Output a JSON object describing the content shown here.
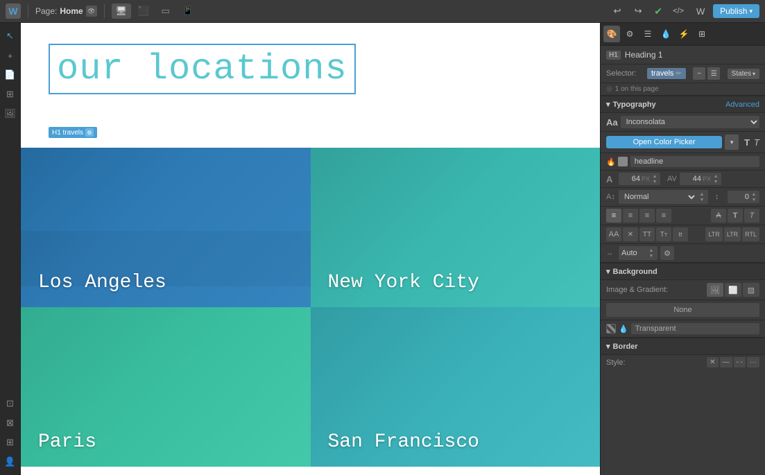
{
  "topbar": {
    "logo": "W",
    "page_label": "Page:",
    "page_name": "Home",
    "publish_label": "Publish",
    "devices": [
      "desktop",
      "tablet-landscape",
      "tablet",
      "mobile"
    ],
    "undo_label": "←",
    "redo_label": "→"
  },
  "canvas": {
    "heading": "our locations",
    "tag_label": "H1 travels",
    "cities": [
      {
        "name": "Los Angeles",
        "key": "la"
      },
      {
        "name": "New York City",
        "key": "nyc"
      },
      {
        "name": "Paris",
        "key": "paris"
      },
      {
        "name": "San Francisco",
        "key": "sf"
      }
    ]
  },
  "right_panel": {
    "top_icons": [
      "style",
      "settings",
      "layout",
      "interactions",
      "lightning",
      "more"
    ],
    "element_label": "Heading 1",
    "h1_badge": "H1",
    "selector_label": "Selector:",
    "selector_tag": "travels",
    "states_label": "States",
    "count_label": "1 on this page",
    "typography_label": "Typography",
    "advanced_label": "Advanced",
    "font_aa": "Aa",
    "font_name": "Inconsolata",
    "color_picker_label": "Open Color Picker",
    "bold_label": "B",
    "italic_label": "I",
    "class_name": "headline",
    "font_size": "64",
    "font_size_unit": "PX",
    "letter_spacing": "44",
    "letter_spacing_unit": "PX",
    "weight_label": "Normal",
    "line_height": "0",
    "align_left": "≡",
    "align_center": "≡",
    "align_right": "≡",
    "align_justify": "≡",
    "background_label": "Background",
    "image_gradient_label": "Image & Gradient:",
    "none_label": "None",
    "transparent_value": "Transparent",
    "border_label": "Border",
    "border_style_label": "Style:"
  }
}
